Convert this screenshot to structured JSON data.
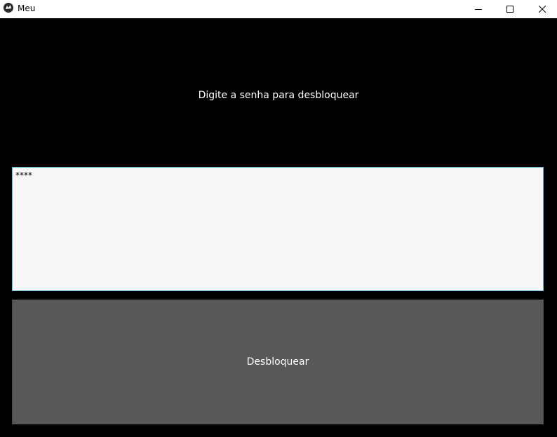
{
  "window": {
    "title": "Meu",
    "icon": "kivy-logo-icon",
    "controls": {
      "minimize": "minimize-icon",
      "maximize": "maximize-icon",
      "close": "close-icon"
    }
  },
  "main": {
    "prompt": "Digite a senha para desbloquear",
    "password_value": "****",
    "unlock_label": "Desbloquear"
  },
  "colors": {
    "background": "#000000",
    "input_background": "#f7f7f7",
    "input_border": "#5fb8d6",
    "button_background": "#585858",
    "text_light": "#ffffff"
  }
}
